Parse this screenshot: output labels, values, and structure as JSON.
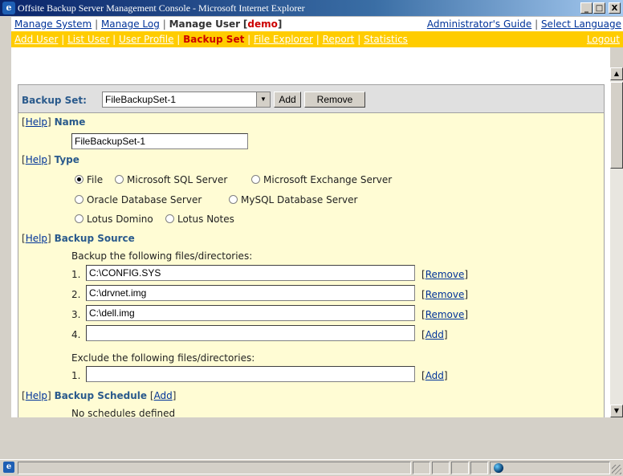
{
  "window": {
    "title": "Offsite Backup Server Management Console - Microsoft Internet Explorer",
    "btn_min": "_",
    "btn_max": "□",
    "btn_close": "X"
  },
  "nav1": {
    "manage_system": "Manage System",
    "manage_log": "Manage Log",
    "manage_user": "Manage User",
    "user": "demo",
    "admin_guide": "Administrator's Guide",
    "select_language": "Select Language",
    "sep": "|"
  },
  "nav2": {
    "add_user": "Add User",
    "list_user": "List User",
    "user_profile": "User Profile",
    "backup_set": "Backup Set",
    "file_explorer": "File Explorer",
    "report": "Report",
    "statistics": "Statistics",
    "logout": "Logout"
  },
  "backup_set": {
    "label": "Backup Set:",
    "selected": "FileBackupSet-1",
    "add_btn": "Add",
    "remove_btn": "Remove",
    "help": "[Help]",
    "help_open": "[",
    "help_word": "Help",
    "help_close": "]",
    "name_label": "Name",
    "name_value": "FileBackupSet-1",
    "type_label": "Type",
    "types": [
      "File",
      "Microsoft SQL Server",
      "Microsoft Exchange Server",
      "Oracle Database Server",
      "MySQL Database Server",
      "Lotus Domino",
      "Lotus Notes"
    ],
    "source_label": "Backup Source",
    "include_text": "Backup the following files/directories:",
    "sources": [
      {
        "num": "1.",
        "value": "C:\\CONFIG.SYS",
        "action": "Remove"
      },
      {
        "num": "2.",
        "value": "C:\\drvnet.img",
        "action": "Remove"
      },
      {
        "num": "3.",
        "value": "C:\\dell.img",
        "action": "Remove"
      },
      {
        "num": "4.",
        "value": "",
        "action": "Add"
      }
    ],
    "exclude_text": "Exclude the following files/directories:",
    "exclude": {
      "num": "1.",
      "value": "",
      "action": "Add"
    },
    "schedule_label": "Backup Schedule",
    "schedule_add": "Add",
    "no_schedule": "No schedules defined"
  }
}
